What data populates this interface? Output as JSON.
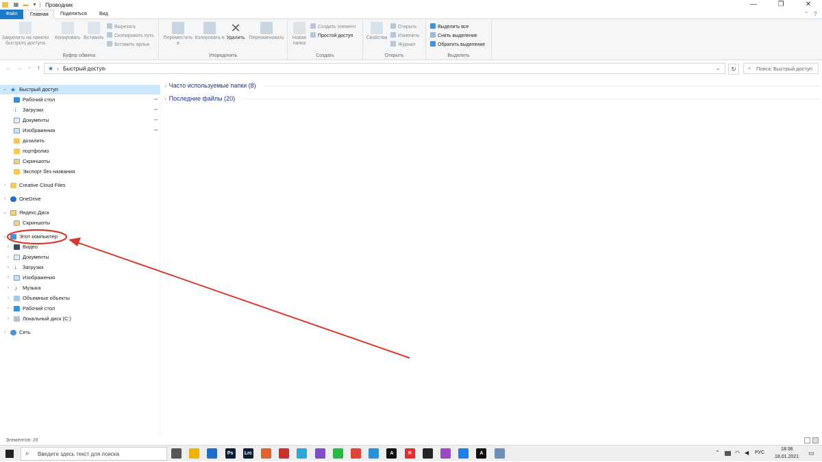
{
  "window": {
    "title": "Проводник",
    "minimize": "—",
    "restore": "❐",
    "close": "✕"
  },
  "tabs": [
    {
      "label": "Файл"
    },
    {
      "label": "Главная"
    },
    {
      "label": "Поделиться"
    },
    {
      "label": "Вид"
    }
  ],
  "ribbon": {
    "clipboard": {
      "group_label": "Буфер обмена",
      "pin": "Закрепить на панели быстрого доступа",
      "copy": "Копировать",
      "paste": "Вставить",
      "cut": "Вырезать",
      "copy_path": "Скопировать путь",
      "paste_shortcut": "Вставить ярлык"
    },
    "organize": {
      "group_label": "Упорядочить",
      "move_to": "Переместить в",
      "copy_to": "Копировать в",
      "delete": "Удалить",
      "rename": "Переименовать"
    },
    "new": {
      "group_label": "Создать",
      "new_folder": "Новая папка",
      "new_item": "Создать элемент",
      "easy_access": "Простой доступ"
    },
    "open": {
      "group_label": "Открыть",
      "properties": "Свойства",
      "open": "Открыть",
      "edit": "Изменить",
      "history": "Журнал"
    },
    "select": {
      "group_label": "Выделить",
      "select_all": "Выделить все",
      "select_none": "Снять выделение",
      "invert": "Обратить выделение"
    }
  },
  "address": {
    "path": "Быстрый доступ",
    "search_placeholder": "Поиск: Быстрый доступ"
  },
  "sidebar": {
    "quick_access": "Быстрый доступ",
    "quick_items": [
      {
        "label": "Рабочий стол",
        "pinned": true
      },
      {
        "label": "Загрузки",
        "pinned": true
      },
      {
        "label": "Документы",
        "pinned": true
      },
      {
        "label": "Изображения",
        "pinned": true
      },
      {
        "label": "дозалить",
        "pinned": false
      },
      {
        "label": "портфолио",
        "pinned": false
      },
      {
        "label": "Скриншоты",
        "pinned": false
      },
      {
        "label": "Экспорт без названия",
        "pinned": false
      }
    ],
    "creative_cloud": "Creative Cloud Files",
    "onedrive": "OneDrive",
    "yandex": "Яндекс.Диск",
    "yandex_items": [
      "Скриншоты"
    ],
    "this_pc": "Этот компьютер",
    "pc_items": [
      {
        "label": "Видео"
      },
      {
        "label": "Документы"
      },
      {
        "label": "Загрузки"
      },
      {
        "label": "Изображения"
      },
      {
        "label": "Музыка"
      },
      {
        "label": "Объемные объекты"
      },
      {
        "label": "Рабочий стол"
      },
      {
        "label": "Локальный диск (C:)"
      }
    ],
    "network": "Сеть",
    "pin_glyph": "📌"
  },
  "content": {
    "frequent": "Часто используемые папки (8)",
    "recent": "Последние файлы (20)"
  },
  "status": {
    "items_count": "Элементов: 28"
  },
  "taskbar": {
    "search_placeholder": "Введите здесь текст для поиска",
    "apps": [
      {
        "name": "task-view",
        "label": "",
        "color": "#555555"
      },
      {
        "name": "explorer",
        "label": "",
        "color": "#f0b400"
      },
      {
        "name": "mail",
        "label": "",
        "color": "#1d6fc6"
      },
      {
        "name": "photoshop",
        "label": "Ps",
        "color": "#0b1e35"
      },
      {
        "name": "lightroom",
        "label": "Lrc",
        "color": "#0b1e35"
      },
      {
        "name": "app-orange",
        "label": "",
        "color": "#e0622c"
      },
      {
        "name": "app-red",
        "label": "",
        "color": "#c8302e"
      },
      {
        "name": "telegram",
        "label": "",
        "color": "#2ea6da"
      },
      {
        "name": "viber",
        "label": "",
        "color": "#7d4fc2"
      },
      {
        "name": "whatsapp",
        "label": "",
        "color": "#2bb741"
      },
      {
        "name": "chrome",
        "label": "",
        "color": "#db4437"
      },
      {
        "name": "app-blue",
        "label": "",
        "color": "#2b8fd6"
      },
      {
        "name": "app-a",
        "label": "A",
        "color": "#111111"
      },
      {
        "name": "yandex-browser",
        "label": "Я",
        "color": "#e52b2b"
      },
      {
        "name": "app-record",
        "label": "",
        "color": "#222222"
      },
      {
        "name": "app-purple",
        "label": "",
        "color": "#9b4ac7"
      },
      {
        "name": "firefox",
        "label": "",
        "color": "#1d7ef0"
      },
      {
        "name": "app-a2",
        "label": "A",
        "color": "#111111"
      },
      {
        "name": "app-window",
        "label": "",
        "color": "#6b8fb5"
      }
    ],
    "language": "РУС",
    "time": "18:36",
    "date": "18.01.2021"
  },
  "colors": {
    "accent": "#1979ca",
    "selection": "#cce8ff",
    "annotation": "#d8392f",
    "section_text": "#1e3287"
  }
}
